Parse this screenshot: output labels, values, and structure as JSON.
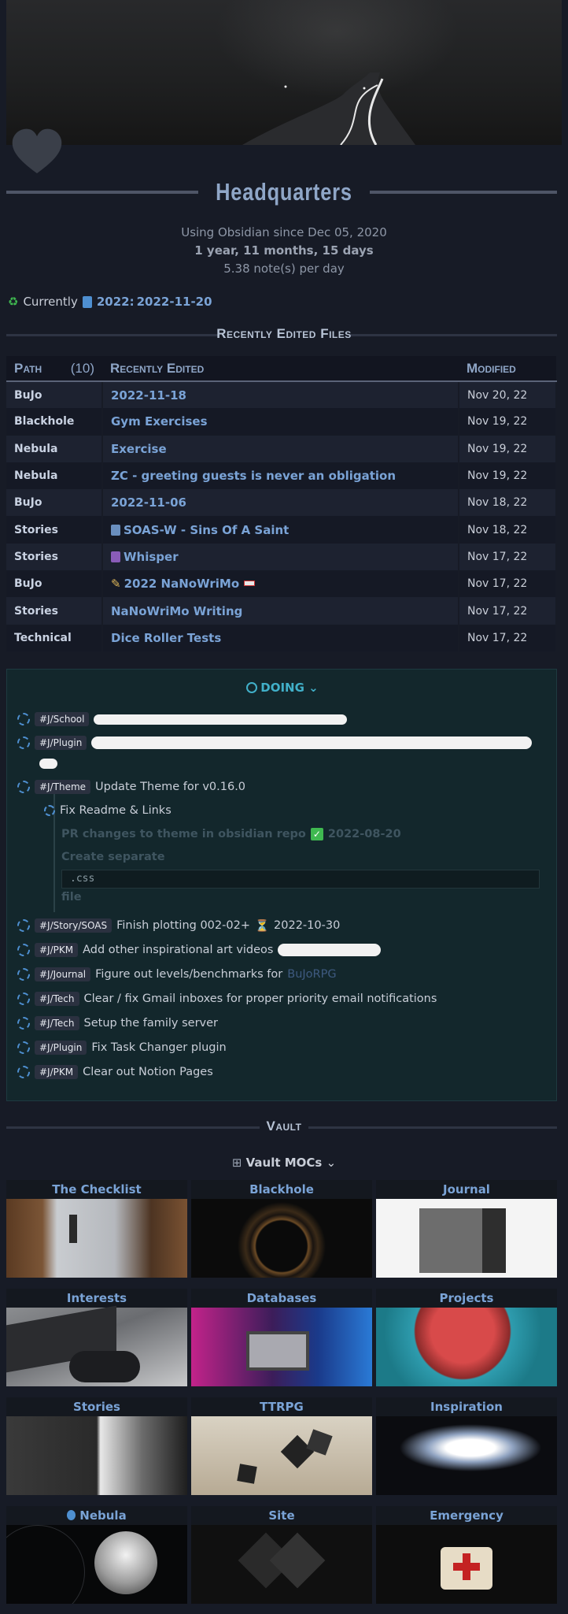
{
  "header": {
    "title": "Headquarters",
    "since": "Using Obsidian since Dec 05, 2020",
    "duration": "1 year, 11 months, 15 days",
    "rate": "5.38 note(s) per day",
    "currently_label": "Currently",
    "currently_year": "2022:",
    "currently_date": "2022-11-20"
  },
  "recent": {
    "section_title": "Recently Edited Files",
    "columns": [
      "Path",
      "Recently Edited",
      "Modified"
    ],
    "count": "(10)",
    "rows": [
      {
        "path": "BuJo",
        "file": "2022-11-18",
        "modified": "Nov 20, 22"
      },
      {
        "path": "Blackhole",
        "file": "Gym Exercises",
        "modified": "Nov 19, 22"
      },
      {
        "path": "Nebula",
        "file": "Exercise",
        "modified": "Nov 19, 22"
      },
      {
        "path": "Nebula",
        "file": "ZC - greeting guests is never an obligation",
        "modified": "Nov 19, 22"
      },
      {
        "path": "BuJo",
        "file": "2022-11-06",
        "modified": "Nov 18, 22"
      },
      {
        "path": "Stories",
        "file": "SOAS-W - Sins Of A Saint",
        "modified": "Nov 18, 22"
      },
      {
        "path": "Stories",
        "file": "Whisper",
        "modified": "Nov 17, 22"
      },
      {
        "path": "BuJo",
        "file": "2022 NaNoWriMo",
        "modified": "Nov 17, 22"
      },
      {
        "path": "Stories",
        "file": "NaNoWriMo Writing",
        "modified": "Nov 17, 22"
      },
      {
        "path": "Technical",
        "file": "Dice Roller Tests",
        "modified": "Nov 17, 22"
      }
    ]
  },
  "doing": {
    "title": "DOING",
    "tasks": [
      {
        "tag": "#J/School",
        "text": ""
      },
      {
        "tag": "#J/Plugin",
        "text": ""
      },
      {
        "tag": "#J/Theme",
        "text": "Update Theme for v0.16.0"
      },
      {
        "sub": "Fix Readme & Links"
      },
      {
        "dim1": "PR changes to theme in obsidian repo",
        "dim1_date": "2022-08-20"
      },
      {
        "dim2": "Create separate",
        "code": ".css",
        "dim3": "file"
      },
      {
        "tag": "#J/Story/SOAS",
        "text": "Finish plotting 002-02+",
        "date": "2022-10-30"
      },
      {
        "tag": "#J/PKM",
        "text": "Add other inspirational art videos"
      },
      {
        "tag": "#J/Journal",
        "text": "Figure out levels/benchmarks for",
        "link": "BuJoRPG"
      },
      {
        "tag": "#J/Tech",
        "text": "Clear / fix Gmail inboxes for proper priority email notifications"
      },
      {
        "tag": "#J/Tech",
        "text": "Setup the family server"
      },
      {
        "tag": "#J/Plugin",
        "text": "Fix Task Changer plugin"
      },
      {
        "tag": "#J/PKM",
        "text": "Clear out Notion Pages"
      }
    ]
  },
  "vault": {
    "section_title": "Vault",
    "mocs_label": "Vault MOCs",
    "cards": [
      "The Checklist",
      "Blackhole",
      "Journal",
      "Interests",
      "Databases",
      "Projects",
      "Stories",
      "TTRPG",
      "Inspiration",
      "Nebula",
      "Site",
      "Emergency"
    ]
  }
}
